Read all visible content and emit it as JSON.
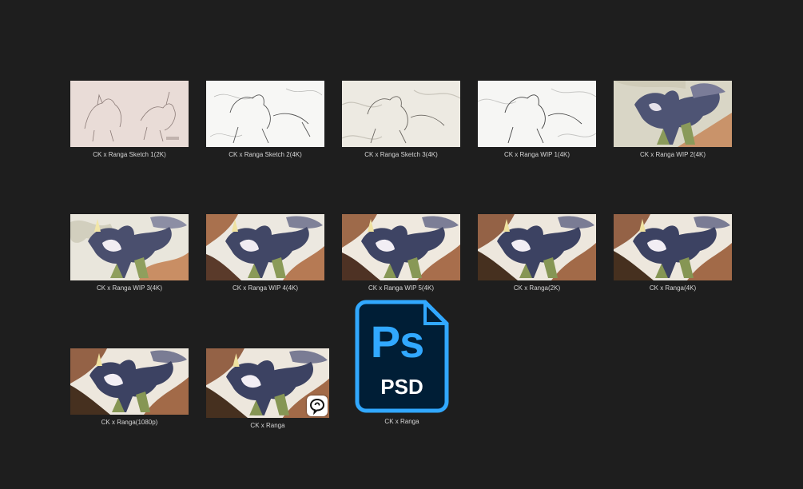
{
  "colors": {
    "background": "#1e1e1e",
    "label_text": "#d6d6d6",
    "ps_blue": "#31a8ff",
    "ps_dark": "#001e36"
  },
  "files": [
    {
      "name": "CK x Ranga Sketch 1(2K)",
      "thumb": "sketch-pink"
    },
    {
      "name": "CK x Ranga Sketch 2(4K)",
      "thumb": "sketch-white"
    },
    {
      "name": "CK x Ranga Sketch 3(4K)",
      "thumb": "sketch-cream"
    },
    {
      "name": "CK x Ranga WIP 1(4K)",
      "thumb": "sketch-white"
    },
    {
      "name": "CK x Ranga WIP 2(4K)",
      "thumb": "flat-color"
    },
    {
      "name": "CK x Ranga WIP 3(4K)",
      "thumb": "painted-light"
    },
    {
      "name": "CK x Ranga WIP 4(4K)",
      "thumb": "painted"
    },
    {
      "name": "CK x Ranga WIP 5(4K)",
      "thumb": "painted"
    },
    {
      "name": "CK x Ranga(2K)",
      "thumb": "painted"
    },
    {
      "name": "CK x Ranga(4K)",
      "thumb": "painted"
    },
    {
      "name": "CK x Ranga(1080p)",
      "thumb": "painted"
    },
    {
      "name": "CK x Ranga",
      "thumb": "painted",
      "badge": "clip-studio-icon"
    },
    {
      "name": "CK x Ranga",
      "icon": "photoshop-psd-icon",
      "icon_letters": "Ps",
      "icon_ext": "PSD"
    }
  ]
}
